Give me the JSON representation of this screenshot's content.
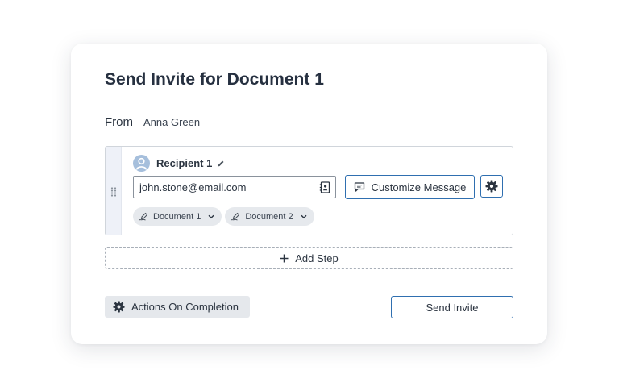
{
  "dialog": {
    "title": "Send Invite for Document 1"
  },
  "from": {
    "label": "From",
    "value": "Anna Green"
  },
  "recipient": {
    "label": "Recipient 1",
    "email": "john.stone@email.com",
    "customize_label": "Customize Message",
    "documents": [
      {
        "label": "Document 1"
      },
      {
        "label": "Document 2"
      }
    ]
  },
  "add_step_label": "Add Step",
  "footer": {
    "actions_label": "Actions On Completion",
    "send_label": "Send Invite"
  },
  "colors": {
    "accent": "#2f6fb0",
    "avatar": "#a6bfdc",
    "chip_bg": "#e6e9ed",
    "strip_bg": "#eef1f8"
  },
  "icons": {
    "drag": "drag-handle-icon",
    "avatar": "user-avatar-icon",
    "edit": "pencil-icon",
    "contacts": "address-book-icon",
    "message": "chat-bubble-icon",
    "settings": "gear-icon",
    "document": "signature-pen-icon",
    "chevron": "chevron-down-icon",
    "add": "plus-icon"
  }
}
